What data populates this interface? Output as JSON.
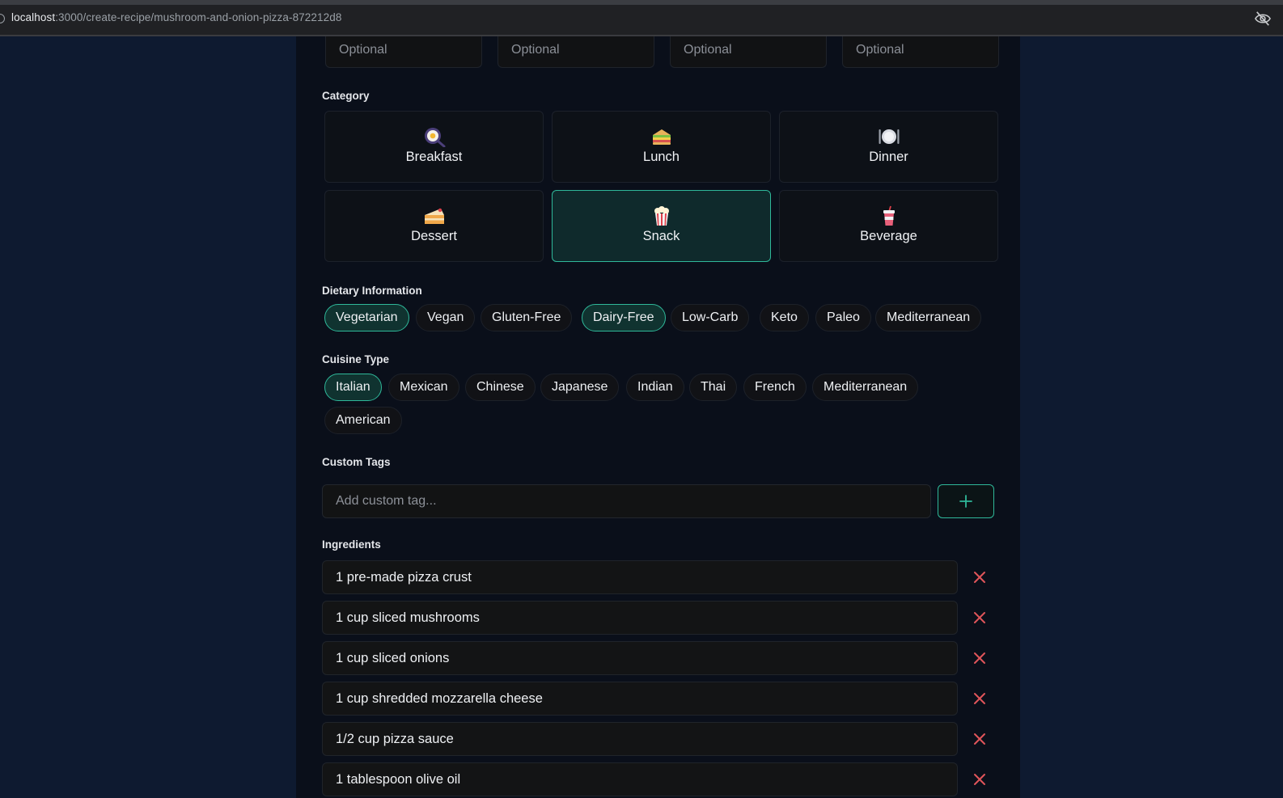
{
  "browser": {
    "url_host": "localhost",
    "url_path": ":3000/create-recipe/mushroom-and-onion-pizza-872212d8"
  },
  "optional_fields": [
    "Optional",
    "Optional",
    "Optional",
    "Optional"
  ],
  "category": {
    "label": "Category",
    "items": [
      {
        "label": "Breakfast",
        "icon": "cooking-egg-icon",
        "selected": false
      },
      {
        "label": "Lunch",
        "icon": "sandwich-icon",
        "selected": false
      },
      {
        "label": "Dinner",
        "icon": "plate-icon",
        "selected": false
      },
      {
        "label": "Dessert",
        "icon": "cake-icon",
        "selected": false
      },
      {
        "label": "Snack",
        "icon": "popcorn-icon",
        "selected": true
      },
      {
        "label": "Beverage",
        "icon": "cup-icon",
        "selected": false
      }
    ]
  },
  "dietary": {
    "label": "Dietary Information",
    "items": [
      {
        "label": "Vegetarian",
        "active": true
      },
      {
        "label": "Vegan",
        "active": false
      },
      {
        "label": "Gluten-Free",
        "active": false
      },
      {
        "label": "Dairy-Free",
        "active": true
      },
      {
        "label": "Low-Carb",
        "active": false
      },
      {
        "label": "Keto",
        "active": false
      },
      {
        "label": "Paleo",
        "active": false
      },
      {
        "label": "Mediterranean",
        "active": false
      }
    ]
  },
  "cuisine": {
    "label": "Cuisine Type",
    "items": [
      {
        "label": "Italian",
        "active": true
      },
      {
        "label": "Mexican",
        "active": false
      },
      {
        "label": "Chinese",
        "active": false
      },
      {
        "label": "Japanese",
        "active": false
      },
      {
        "label": "Indian",
        "active": false
      },
      {
        "label": "Thai",
        "active": false
      },
      {
        "label": "French",
        "active": false
      },
      {
        "label": "Mediterranean",
        "active": false
      },
      {
        "label": "American",
        "active": false
      }
    ]
  },
  "custom_tags": {
    "label": "Custom Tags",
    "placeholder": "Add custom tag...",
    "add_icon": "plus-icon"
  },
  "ingredients": {
    "label": "Ingredients",
    "items": [
      "1 pre-made pizza crust",
      "1 cup sliced mushrooms",
      "1 cup sliced onions",
      "1 cup shredded mozzarella cheese",
      "1/2 cup pizza sauce",
      "1 tablespoon olive oil"
    ]
  },
  "colors": {
    "accent": "#2fb89a",
    "remove": "#e0555a",
    "page_bg": "#0e1a30",
    "panel_bg": "#0a0f1a"
  }
}
